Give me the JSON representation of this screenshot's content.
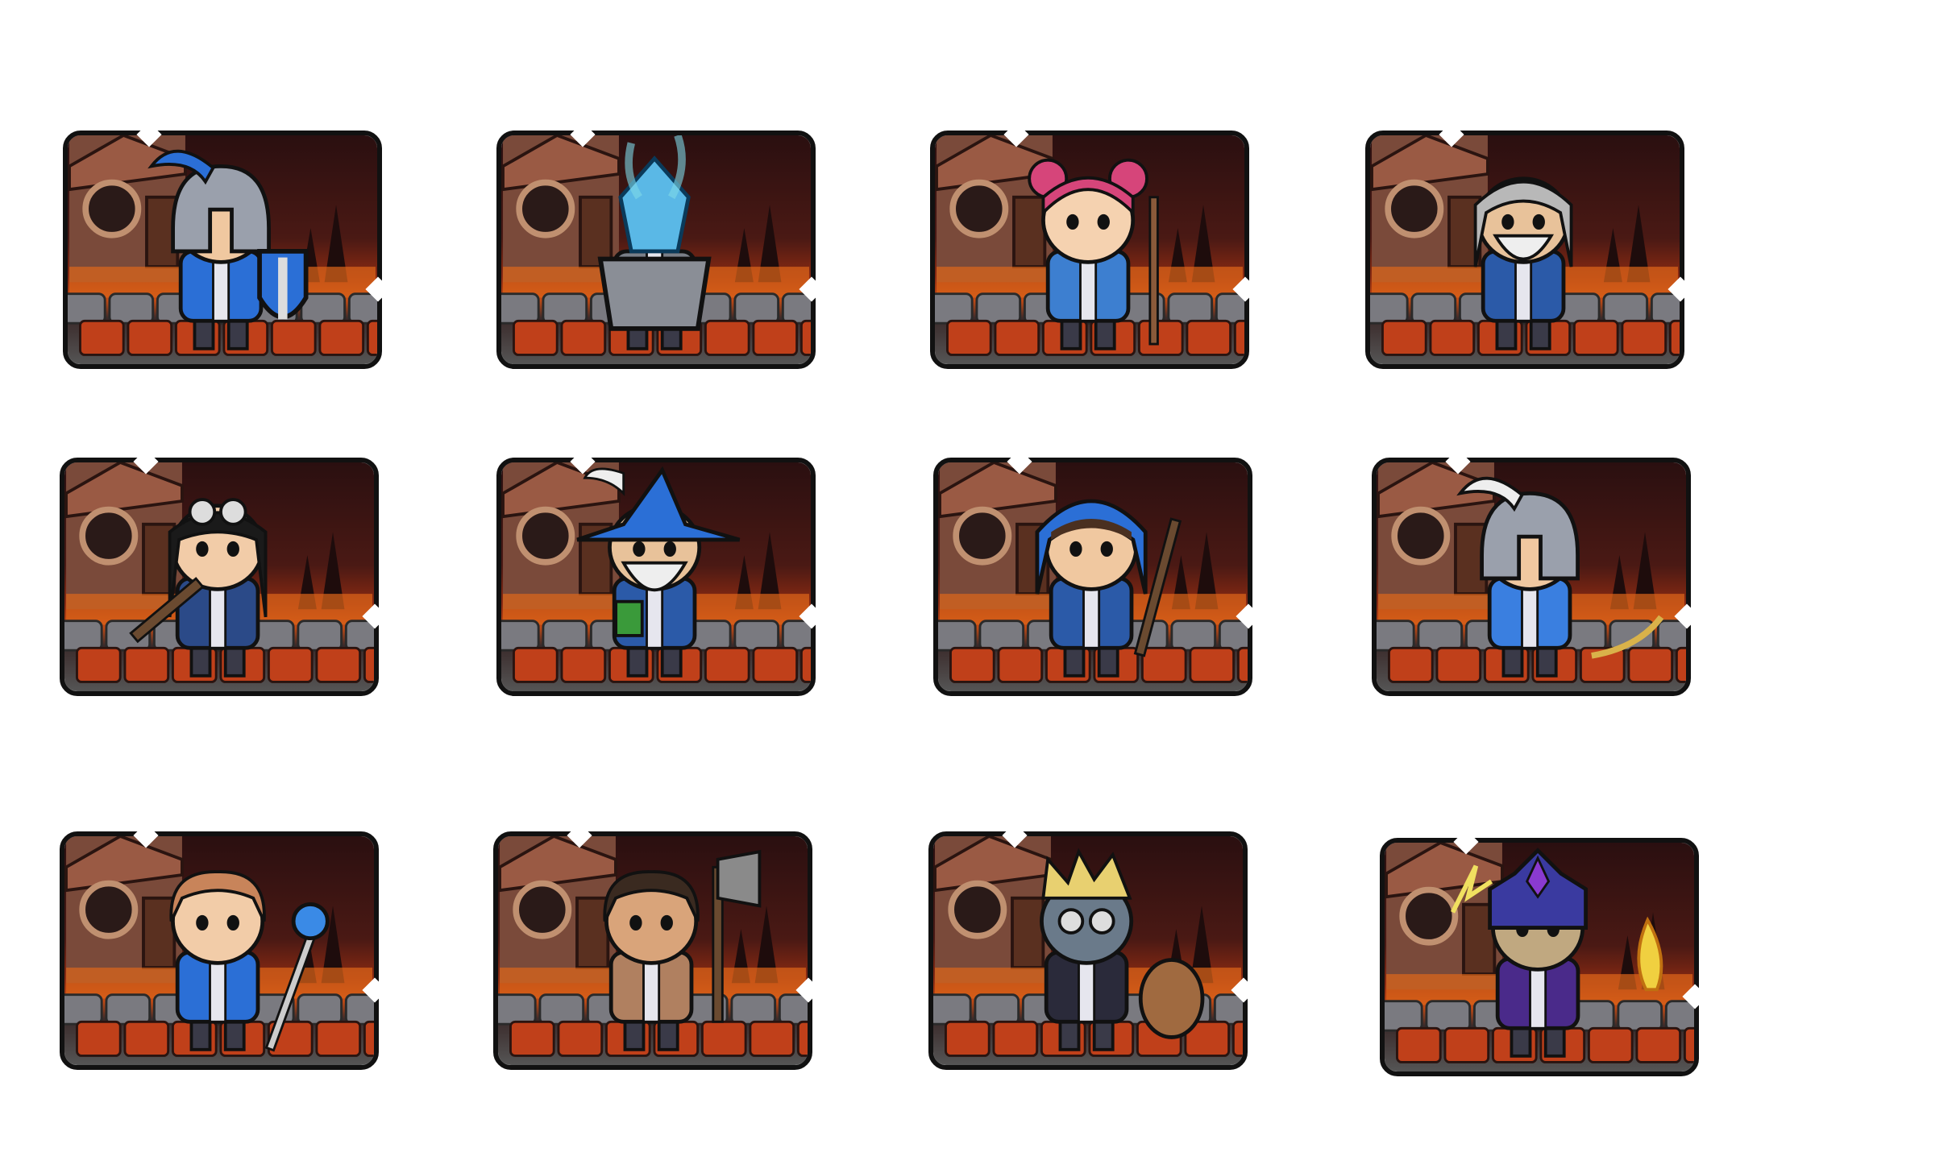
{
  "palette": {
    "outline": "#111111",
    "sky": "#2a0f10",
    "lava": "#e0661a",
    "stone": "#7a7a80",
    "house": "#7a4a3a",
    "team_blue": "#2b6fd6",
    "gold": "#d9b24a"
  },
  "heroes": [
    {
      "key": "knight",
      "portrait_icon": "shield-knight-icon",
      "head": "helmet",
      "headColor": "#9aa0ac",
      "plume": "#2b6fd6",
      "body": "#2b6fd6",
      "prop": "shield",
      "propColor": "#2b6fd6",
      "skin": "#f0c8a0"
    },
    {
      "key": "crystal",
      "portrait_icon": "crystal-brazier-icon",
      "head": "crystal",
      "headColor": "#5ab8e6",
      "plume": "#7fd9e8",
      "body": "#7a7f88",
      "prop": "none",
      "propColor": "#7a7f88",
      "skin": "#f0c8a0"
    },
    {
      "key": "healer",
      "portrait_icon": "pink-hair-girl-icon",
      "head": "buns",
      "headColor": "#d6457a",
      "plume": "#d6457a",
      "body": "#3d7fd0",
      "prop": "staff",
      "propColor": "#8a5a3a",
      "skin": "#f5d2b0"
    },
    {
      "key": "elder",
      "portrait_icon": "bearded-elder-icon",
      "head": "longhair",
      "headColor": "#b8b8b8",
      "plume": "#b8b8b8",
      "body": "#2b5aa8",
      "prop": "none",
      "propColor": "#d9b24a",
      "skin": "#e8c29a"
    },
    {
      "key": "gunner",
      "portrait_icon": "goggles-girl-icon",
      "head": "goggles",
      "headColor": "#1a1a1a",
      "plume": "#1a1a1a",
      "body": "#2b4a88",
      "prop": "rifle",
      "propColor": "#6a4a30",
      "skin": "#f2cca8"
    },
    {
      "key": "wizard",
      "portrait_icon": "wizard-hat-icon",
      "head": "wizard",
      "headColor": "#2b6fd6",
      "plume": "#eeeeee",
      "body": "#2b5aa8",
      "prop": "book",
      "propColor": "#3a9a3a",
      "skin": "#e8c29a"
    },
    {
      "key": "ranger",
      "portrait_icon": "hooded-crossbow-icon",
      "head": "hood",
      "headColor": "#2b6fd6",
      "plume": "#2b6fd6",
      "body": "#2b5aa8",
      "prop": "crossbow",
      "propColor": "#6a4a30",
      "skin": "#f0c8a0"
    },
    {
      "key": "archer",
      "portrait_icon": "feather-helm-archer-icon",
      "head": "helmet",
      "headColor": "#9aa0ac",
      "plume": "#eeeeee",
      "body": "#3a7fe0",
      "prop": "bow",
      "propColor": "#d9b24a",
      "skin": "#f0c8a0"
    },
    {
      "key": "mage",
      "portrait_icon": "orb-staff-mage-icon",
      "head": "hair",
      "headColor": "#c8845a",
      "plume": "#c8845a",
      "body": "#2b6fd6",
      "prop": "orbstaff",
      "propColor": "#3a8ae6",
      "skin": "#f2cca8"
    },
    {
      "key": "barbarian",
      "portrait_icon": "axe-barbarian-icon",
      "head": "hair",
      "headColor": "#3a2a20",
      "plume": "#3a2a20",
      "body": "#b08060",
      "prop": "axe",
      "propColor": "#8a8a8a",
      "skin": "#d9a47a"
    },
    {
      "key": "engineer",
      "portrait_icon": "goggles-engineer-icon",
      "head": "spiky",
      "headColor": "#e8d070",
      "plume": "#e8d070",
      "body": "#2a2a3a",
      "prop": "pet",
      "propColor": "#a06a40",
      "skin": "#6a7a8a"
    },
    {
      "key": "warlock",
      "portrait_icon": "lightning-warlock-icon",
      "head": "crown",
      "headColor": "#3a3aa0",
      "plume": "#8a3ad0",
      "body": "#4a2a8a",
      "prop": "flame",
      "propColor": "#f0d040",
      "skin": "#c0a880"
    }
  ]
}
